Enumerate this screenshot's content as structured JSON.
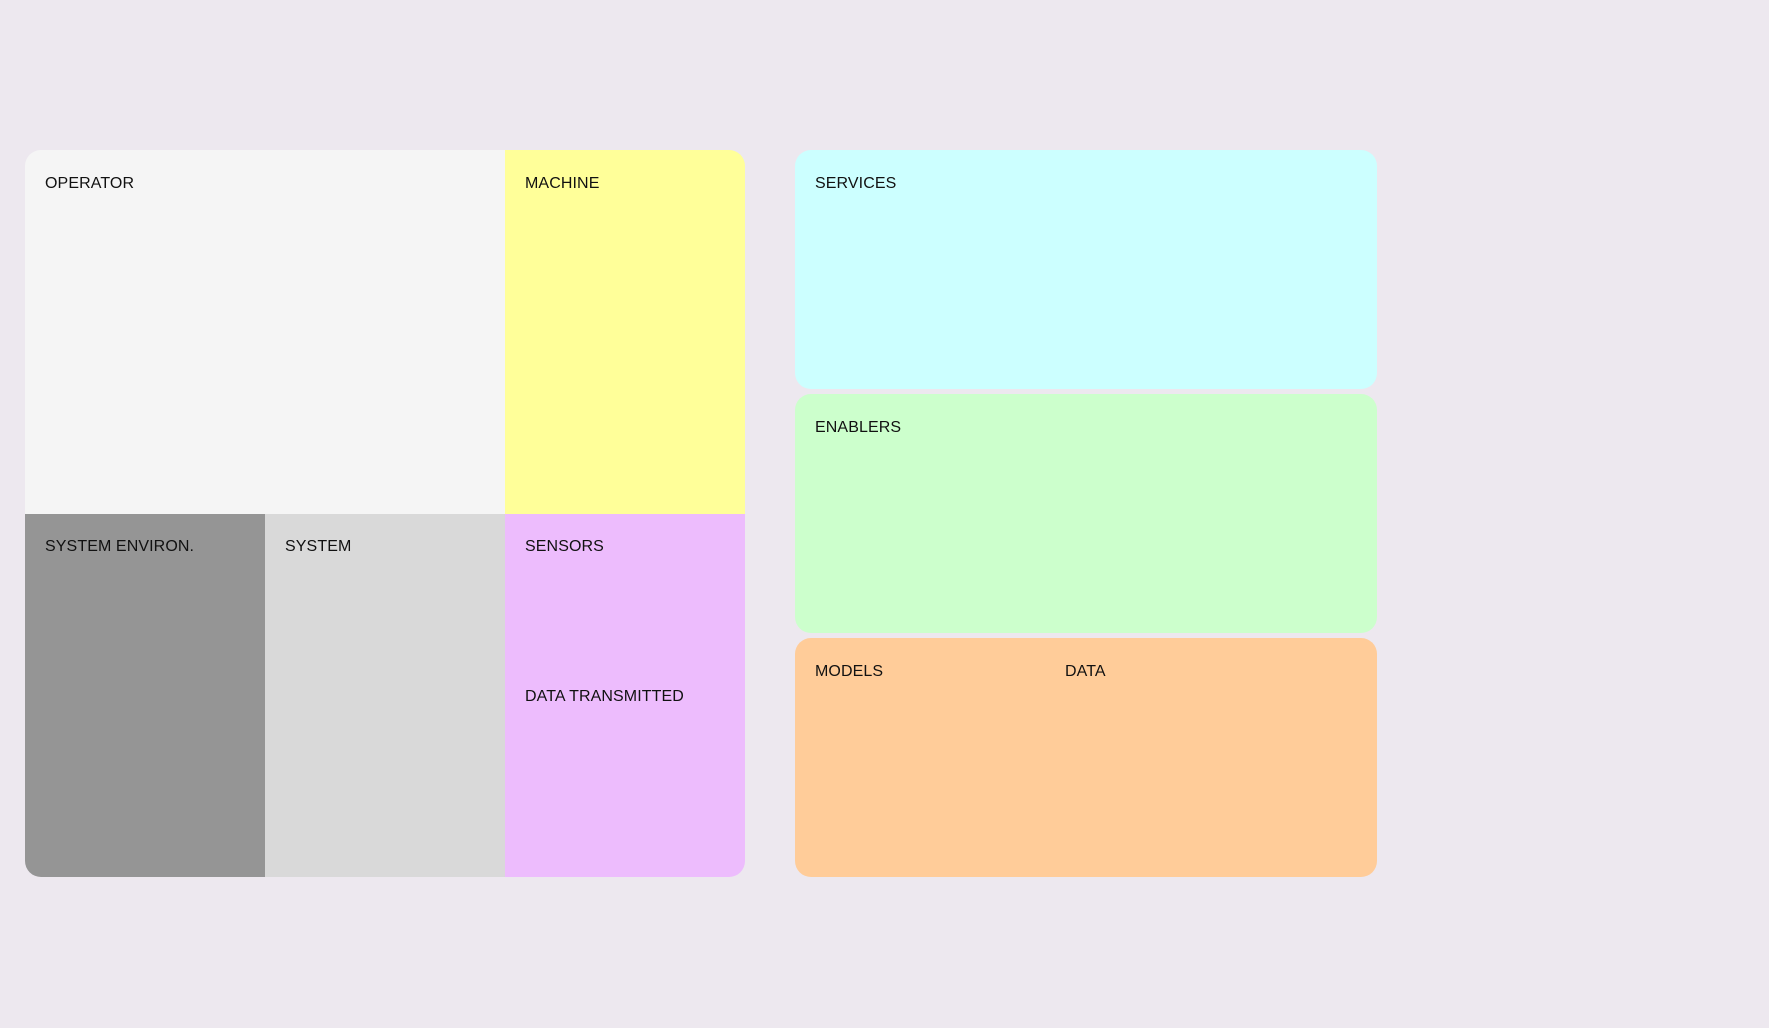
{
  "canvas": {
    "background": "#ede8ef"
  },
  "left_board": {
    "operator": {
      "label": "OPERATOR",
      "color": "#f5f5f5"
    },
    "machine": {
      "label": "MACHINE",
      "color": "#ffff99"
    },
    "system_environment": {
      "label": "SYSTEM ENVIRON.",
      "color": "#959595"
    },
    "system": {
      "label": "SYSTEM",
      "color": "#d9d9d9"
    },
    "sensors": {
      "label": "SENSORS",
      "secondary_label": "DATA TRANSMITTED",
      "color": "#edbcfd"
    }
  },
  "right_column": {
    "services": {
      "label": "SERVICES",
      "color": "#ccffff"
    },
    "enablers": {
      "label": "ENABLERS",
      "color": "#ccffcc"
    },
    "models_data": {
      "label": "MODELS",
      "secondary_label": "DATA",
      "color": "#ffcc99"
    }
  }
}
